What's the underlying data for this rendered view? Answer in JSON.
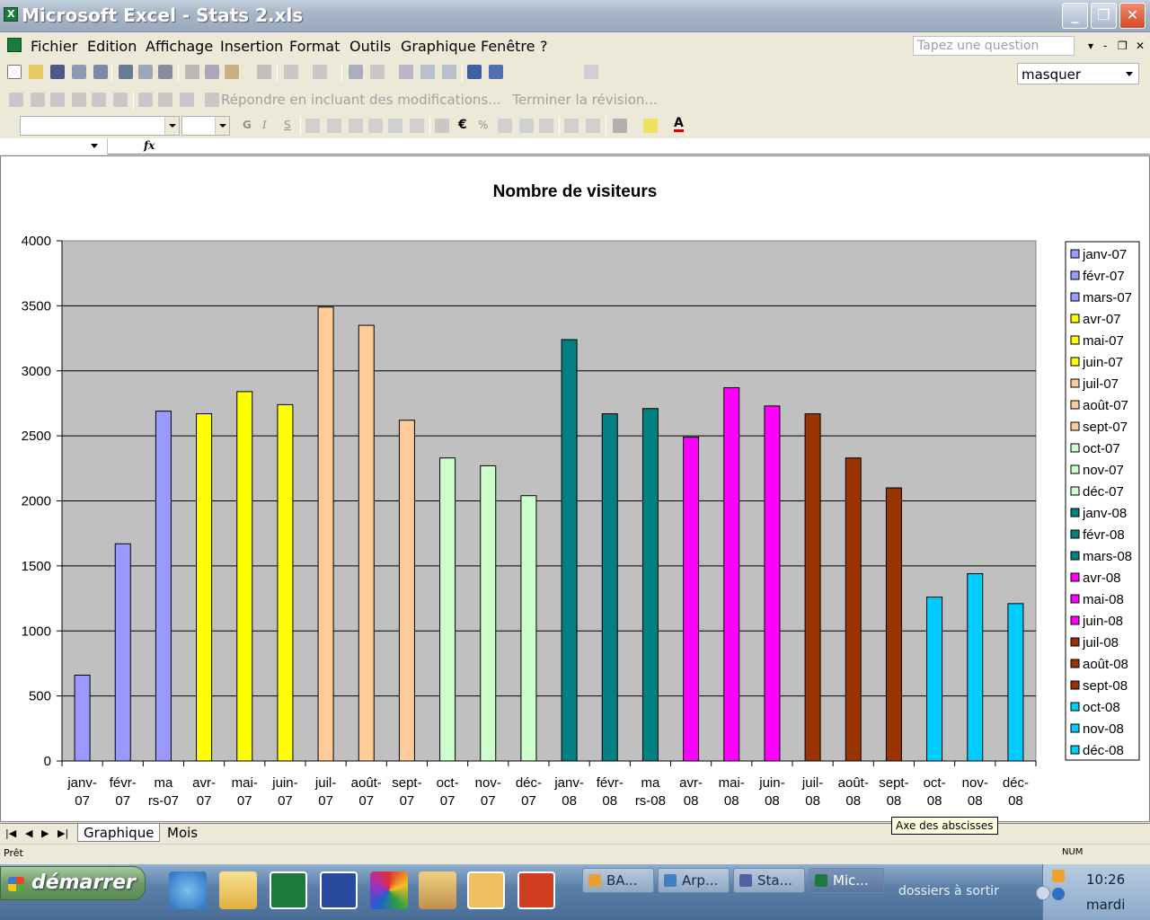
{
  "window": {
    "title": "Microsoft Excel - Stats 2.xls"
  },
  "menu": [
    "Fichier",
    "Edition",
    "Affichage",
    "Insertion",
    "Format",
    "Outils",
    "Graphique",
    "Fenêtre",
    "?"
  ],
  "question_box": {
    "placeholder": "Tapez une question"
  },
  "reviewing_toolbar": {
    "reply_label": "Répondre en incluant des modifications...",
    "end_label": "Terminer la révision..."
  },
  "masquer": "masquer",
  "chart_data": {
    "type": "bar",
    "title": "Nombre de visiteurs",
    "categories": [
      "janv-07",
      "févr-07",
      "mars-07",
      "avr-07",
      "mai-07",
      "juin-07",
      "juil-07",
      "août-07",
      "sept-07",
      "oct-07",
      "nov-07",
      "déc-07",
      "janv-08",
      "févr-08",
      "mars-08",
      "avr-08",
      "mai-08",
      "juin-08",
      "juil-08",
      "août-08",
      "sept-08",
      "oct-08",
      "nov-08",
      "déc-08"
    ],
    "axis_labels": [
      [
        "janv-",
        "07"
      ],
      [
        "févr-",
        "07"
      ],
      [
        "ma",
        "rs-07"
      ],
      [
        "avr-",
        "07"
      ],
      [
        "mai-",
        "07"
      ],
      [
        "juin-",
        "07"
      ],
      [
        "juil-",
        "07"
      ],
      [
        "août-",
        "07"
      ],
      [
        "sept-",
        "07"
      ],
      [
        "oct-",
        "07"
      ],
      [
        "nov-",
        "07"
      ],
      [
        "déc-",
        "07"
      ],
      [
        "janv-",
        "08"
      ],
      [
        "févr-",
        "08"
      ],
      [
        "ma",
        "rs-08"
      ],
      [
        "avr-",
        "08"
      ],
      [
        "mai-",
        "08"
      ],
      [
        "juin-",
        "08"
      ],
      [
        "juil-",
        "08"
      ],
      [
        "août-",
        "08"
      ],
      [
        "sept-",
        "08"
      ],
      [
        "oct-",
        "08"
      ],
      [
        "nov-",
        "08"
      ],
      [
        "déc-",
        "08"
      ]
    ],
    "values": [
      660,
      1670,
      2690,
      2670,
      2840,
      2740,
      3490,
      3350,
      2620,
      2330,
      2270,
      2040,
      3240,
      2670,
      2710,
      2490,
      2870,
      2730,
      2670,
      2330,
      2100,
      1260,
      1440,
      1210
    ],
    "colors": [
      "#9999ff",
      "#9999ff",
      "#9999ff",
      "#ffff00",
      "#ffff00",
      "#ffff00",
      "#ffcc99",
      "#ffcc99",
      "#ffcc99",
      "#ccffcc",
      "#ccffcc",
      "#ccffcc",
      "#008080",
      "#008080",
      "#008080",
      "#ff00ff",
      "#ff00ff",
      "#ff00ff",
      "#993300",
      "#993300",
      "#993300",
      "#00ccff",
      "#00ccff",
      "#00ccff"
    ],
    "ylim": [
      0,
      4000
    ],
    "yticks": [
      0,
      500,
      1000,
      1500,
      2000,
      2500,
      3000,
      3500,
      4000
    ],
    "grid": true,
    "plot_background": "#c0c0c0",
    "legend_position": "right"
  },
  "sheet_tabs": [
    "Graphique",
    "Mois"
  ],
  "tooltip": "Axe des abscisses",
  "status": {
    "left": "Prêt",
    "num": "NUM"
  },
  "taskbar": {
    "start_label": "démarrer",
    "buttons": [
      "BA...",
      "Arp...",
      "Sta...",
      "Mic..."
    ],
    "folder_label": "dossiers à sortir",
    "clock": "10:26",
    "day": "mardi"
  }
}
